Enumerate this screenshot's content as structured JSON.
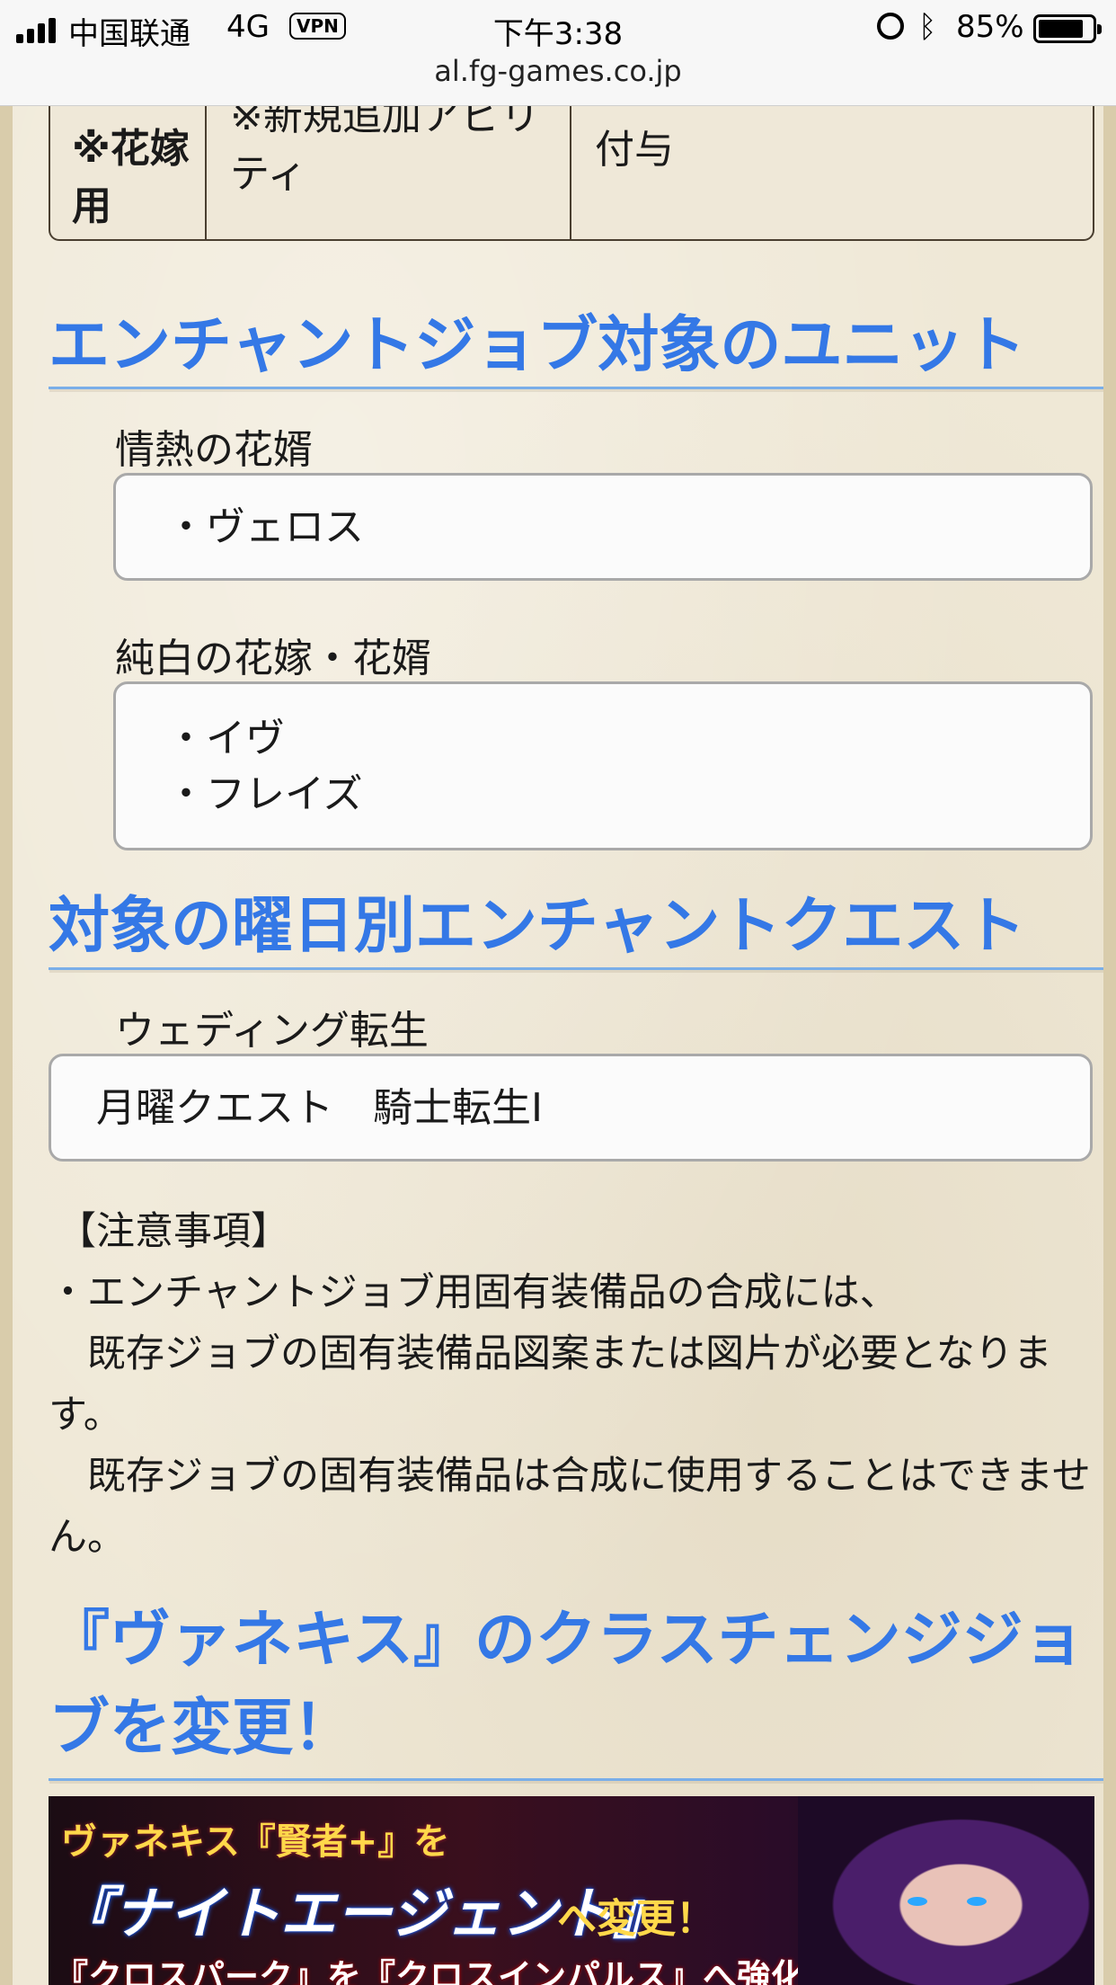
{
  "status_bar": {
    "carrier": "中国联通",
    "network": "4G",
    "vpn": "VPN",
    "time": "下午3:38",
    "battery_percent": "85%",
    "battery_level": 0.85,
    "url": "al.fg-games.co.jp"
  },
  "ability_table": {
    "col1": "※花嫁用",
    "col2": "※新規追加アビリティ",
    "col3": "付与"
  },
  "section_units": {
    "heading": "エンチャントジョブ対象のユニット",
    "groups": [
      {
        "label": "情熱の花婿",
        "items": [
          "・ヴェロス"
        ]
      },
      {
        "label": "純白の花嫁・花婿",
        "items": [
          "・イヴ",
          "・フレイズ"
        ]
      }
    ]
  },
  "section_quest": {
    "heading": "対象の曜日別エンチャントクエスト",
    "label": "ウェディング転生",
    "quest": "月曜クエスト　騎士転生Ⅰ"
  },
  "notes": {
    "title": "【注意事項】",
    "line1": "・エンチャントジョブ用固有装備品の合成には、",
    "line2": "　既存ジョブの固有装備品図案または図片が必要となります。",
    "line3": "　既存ジョブの固有装備品は合成に使用することはできません。"
  },
  "section_vanekis": {
    "heading": "『ヴァネキス』のクラスチェンジジョブを変更！"
  },
  "banner": {
    "line1": "ヴァネキス『賢者+』を",
    "line2": "『ナイトエージェント』",
    "line3": "へ変更！",
    "line4": "『クロスパーク』を『クロスインパルス』へ強化！"
  }
}
